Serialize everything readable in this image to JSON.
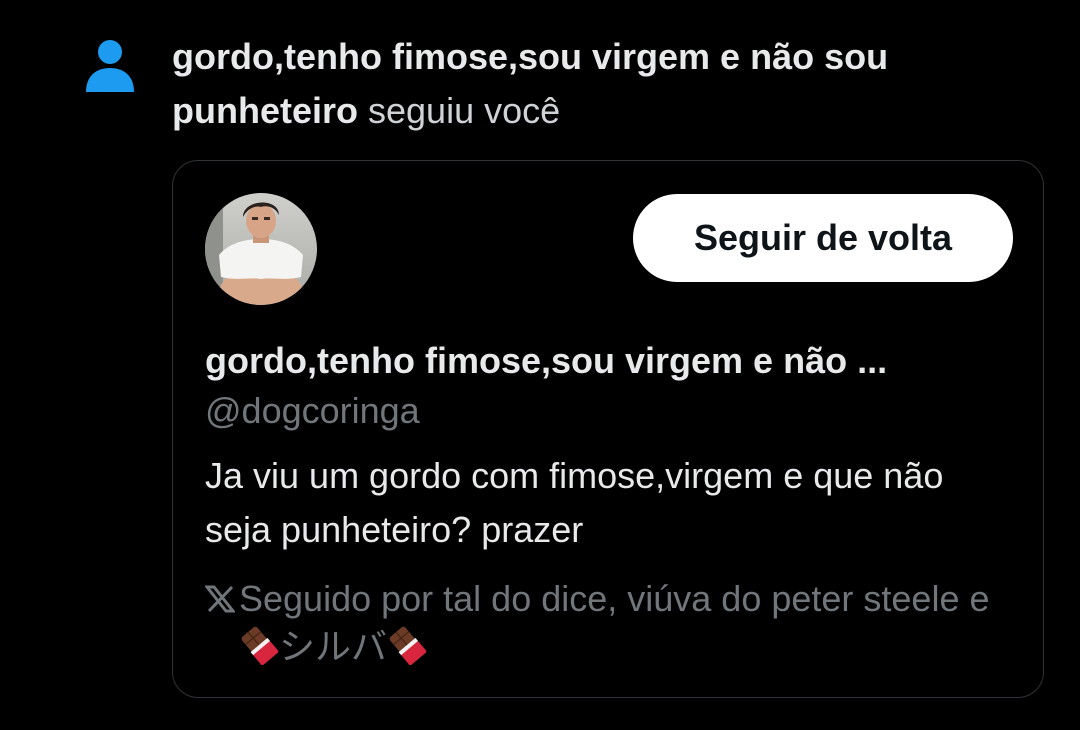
{
  "notification": {
    "icon": "person-icon",
    "follower_name": "gordo,tenho fimose,sou virgem e não sou punheteiro",
    "action_text": "seguiu você"
  },
  "card": {
    "avatar_icon": "profile-avatar",
    "follow_back_label": "Seguir de volta",
    "display_name": "gordo,tenho fimose,sou virgem e não ...",
    "handle": "@dogcoringa",
    "bio": "Ja viu um gordo com fimose,virgem e que não seja punheteiro? prazer",
    "followed_by": {
      "icon": "x-logo-icon",
      "prefix": "Seguido por tal do dice, viúva do peter steele e ",
      "emoji_name": "chocolate-bar-icon",
      "highlight_name": "シルバ"
    }
  },
  "colors": {
    "background": "#000000",
    "accent_blue": "#1d9bf0",
    "primary_text": "#e7e9ea",
    "secondary_text": "#71767b",
    "card_border": "#2f3336",
    "button_bg": "#ffffff",
    "button_text": "#0f1419"
  }
}
